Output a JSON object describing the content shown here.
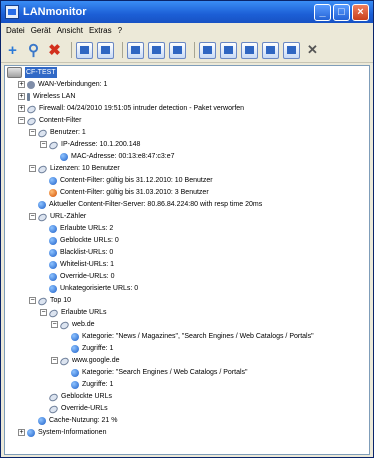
{
  "window": {
    "title": "LANmonitor"
  },
  "menu": [
    "Datei",
    "Gerät",
    "Ansicht",
    "Extras",
    "?"
  ],
  "toolbar": [
    "add-icon",
    "user-search-icon",
    "delete-icon",
    "window-icon",
    "window-arrow-icon",
    "grid-icon",
    "table-icon",
    "panel-icon",
    "list-icon",
    "view-icon",
    "search-icon",
    "chart-icon",
    "edit-icon",
    "tools-icon"
  ],
  "tree": [
    {
      "level": 0,
      "expander": "",
      "icon": "root",
      "text": "CF-TEST",
      "selected": true
    },
    {
      "level": 1,
      "expander": "+",
      "icon": "net",
      "text": "WAN-Verbindungen: 1"
    },
    {
      "level": 1,
      "expander": "+",
      "icon": "wlan",
      "text": "Wireless LAN"
    },
    {
      "level": 1,
      "expander": "+",
      "icon": "dish",
      "text": "Firewall: 04/24/2010 19:51:05 intruder detection - Paket verworfen"
    },
    {
      "level": 1,
      "expander": "−",
      "icon": "dish",
      "text": "Content-Filter"
    },
    {
      "level": 2,
      "expander": "−",
      "icon": "dish",
      "text": "Benutzer: 1"
    },
    {
      "level": 3,
      "expander": "−",
      "icon": "dish",
      "text": "IP-Adresse: 10.1.200.148"
    },
    {
      "level": 4,
      "expander": "",
      "icon": "info",
      "text": "MAC-Adresse: 00:13:e8:47:c3:e7"
    },
    {
      "level": 2,
      "expander": "−",
      "icon": "dish",
      "text": "Lizenzen: 10 Benutzer"
    },
    {
      "level": 3,
      "expander": "",
      "icon": "info",
      "text": "Content-Filter: gültig bis 31.12.2010: 10 Benutzer"
    },
    {
      "level": 3,
      "expander": "",
      "icon": "warn",
      "text": "Content-Filter: gültig bis 31.03.2010: 3 Benutzer"
    },
    {
      "level": 2,
      "expander": "",
      "icon": "info",
      "text": "Aktueller Content-Filter-Server: 80.86.84.224:80 with resp time 20ms"
    },
    {
      "level": 2,
      "expander": "−",
      "icon": "dish",
      "text": "URL-Zähler"
    },
    {
      "level": 3,
      "expander": "",
      "icon": "info",
      "text": "Erlaubte URLs: 2"
    },
    {
      "level": 3,
      "expander": "",
      "icon": "info",
      "text": "Geblockte URLs: 0"
    },
    {
      "level": 3,
      "expander": "",
      "icon": "info",
      "text": "Blacklist-URLs: 0"
    },
    {
      "level": 3,
      "expander": "",
      "icon": "info",
      "text": "Whitelist-URLs: 1"
    },
    {
      "level": 3,
      "expander": "",
      "icon": "info",
      "text": "Override-URLs: 0"
    },
    {
      "level": 3,
      "expander": "",
      "icon": "info",
      "text": "Unkategorisierte URLs: 0"
    },
    {
      "level": 2,
      "expander": "−",
      "icon": "dish",
      "text": "Top 10"
    },
    {
      "level": 3,
      "expander": "−",
      "icon": "dish",
      "text": "Erlaubte URLs"
    },
    {
      "level": 4,
      "expander": "−",
      "icon": "dish",
      "text": "web.de"
    },
    {
      "level": 5,
      "expander": "",
      "icon": "info",
      "text": "Kategorie: \"News / Magazines\", \"Search Engines / Web Catalogs / Portals\""
    },
    {
      "level": 5,
      "expander": "",
      "icon": "info",
      "text": "Zugriffe: 1"
    },
    {
      "level": 4,
      "expander": "−",
      "icon": "dish",
      "text": "www.google.de"
    },
    {
      "level": 5,
      "expander": "",
      "icon": "info",
      "text": "Kategorie: \"Search Engines / Web Catalogs / Portals\""
    },
    {
      "level": 5,
      "expander": "",
      "icon": "info",
      "text": "Zugriffe: 1"
    },
    {
      "level": 3,
      "expander": "",
      "icon": "dish",
      "text": "Geblockte URLs"
    },
    {
      "level": 3,
      "expander": "",
      "icon": "dish",
      "text": "Override-URLs"
    },
    {
      "level": 2,
      "expander": "",
      "icon": "info",
      "text": "Cache-Nutzung: 21 %"
    },
    {
      "level": 1,
      "expander": "+",
      "icon": "info",
      "text": "System-Informationen"
    }
  ]
}
